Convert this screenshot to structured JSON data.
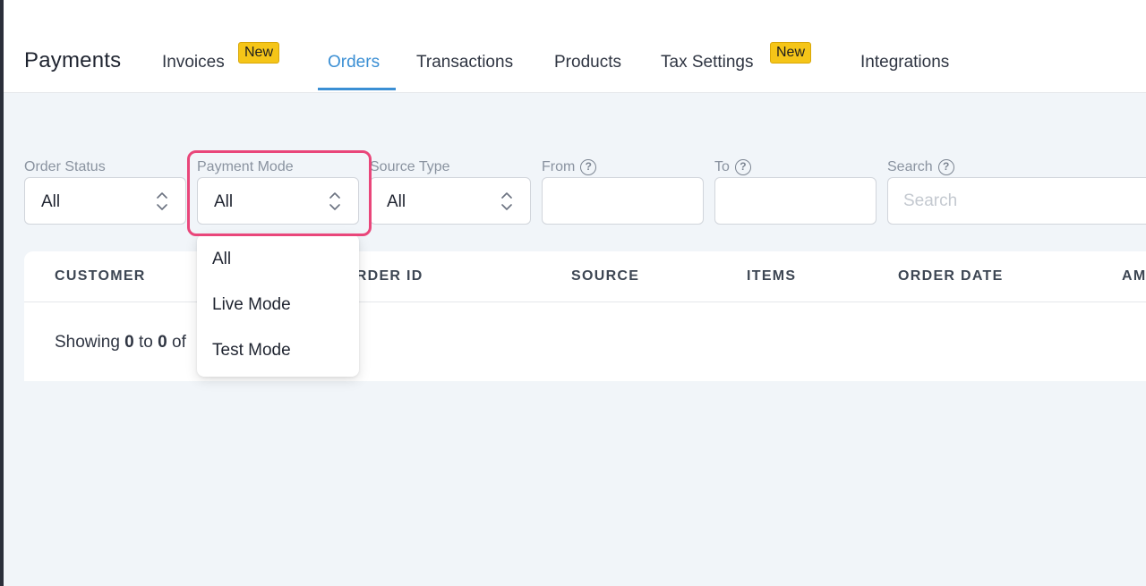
{
  "app": {
    "title": "Payments"
  },
  "tabs": [
    {
      "label": "Invoices",
      "badge": "New"
    },
    {
      "label": "Orders",
      "active": true
    },
    {
      "label": "Transactions"
    },
    {
      "label": "Products"
    },
    {
      "label": "Tax Settings",
      "badge": "New"
    },
    {
      "label": "Integrations"
    }
  ],
  "filters": {
    "order_status": {
      "label": "Order Status",
      "value": "All"
    },
    "payment_mode": {
      "label": "Payment Mode",
      "value": "All",
      "options": [
        "All",
        "Live Mode",
        "Test Mode"
      ]
    },
    "source_type": {
      "label": "Source Type",
      "value": "All"
    },
    "from": {
      "label": "From",
      "value": ""
    },
    "to": {
      "label": "To",
      "value": ""
    },
    "search": {
      "label": "Search",
      "placeholder": "Search",
      "value": ""
    }
  },
  "table": {
    "columns": [
      "CUSTOMER",
      "ORDER ID",
      "SOURCE",
      "ITEMS",
      "ORDER DATE",
      "AM"
    ],
    "showing": {
      "prefix": "Showing",
      "from": "0",
      "to_word": "to",
      "to": "0",
      "suffix": "of"
    }
  },
  "colors": {
    "accent": "#3b8fd4",
    "badge": "#f5c518",
    "highlight": "#e9467a",
    "background": "#f1f5f9"
  },
  "icons": {
    "help": "?",
    "chevron": "up-down-chevron"
  }
}
